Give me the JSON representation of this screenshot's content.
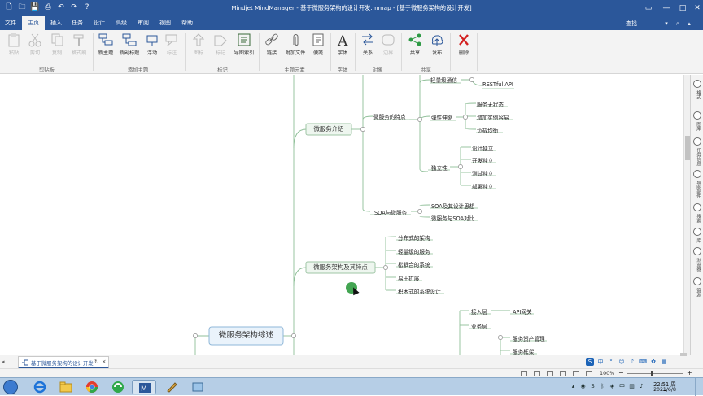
{
  "window": {
    "title": "Mindjet MindManager - 基于微服务架构的设计开发.mmap - [基于微服务架构的设计开发]",
    "quick_access": [
      "new-doc-icon",
      "open-folder-icon",
      "save-icon",
      "print-icon",
      "undo-icon",
      "redo-icon",
      "help-icon"
    ],
    "controls": {
      "minimize": "—",
      "maximize": "□",
      "close": "✕"
    }
  },
  "tabs": [
    "文件",
    "主页",
    "插入",
    "任务",
    "设计",
    "高级",
    "审阅",
    "视图",
    "帮助"
  ],
  "active_tab": "主页",
  "search_label": "查找",
  "ribbon": {
    "groups": [
      {
        "label": "剪贴板",
        "buttons": [
          {
            "label": "粘贴",
            "icon": "paste-icon",
            "enabled": false
          },
          {
            "label": "剪切",
            "icon": "cut-icon",
            "enabled": false
          },
          {
            "label": "复制",
            "icon": "copy-icon",
            "enabled": false
          },
          {
            "label": "格式刷",
            "icon": "format-painter-icon",
            "enabled": false
          }
        ]
      },
      {
        "label": "添加主题",
        "buttons": [
          {
            "label": "新主题",
            "icon": "new-topic-icon",
            "enabled": true
          },
          {
            "label": "新副标题",
            "icon": "new-subtopic-icon",
            "enabled": true
          },
          {
            "label": "浮动",
            "icon": "floating-topic-icon",
            "enabled": true
          },
          {
            "label": "标注",
            "icon": "callout-icon",
            "enabled": false
          }
        ]
      },
      {
        "label": "标记",
        "buttons": [
          {
            "label": "图标",
            "icon": "icon-marker-icon",
            "enabled": false
          },
          {
            "label": "标记",
            "icon": "tag-icon",
            "enabled": false
          },
          {
            "label": "导图索引",
            "icon": "map-index-icon",
            "enabled": true
          }
        ]
      },
      {
        "label": "主题元素",
        "buttons": [
          {
            "label": "链接",
            "icon": "link-icon",
            "enabled": true
          },
          {
            "label": "附加文件",
            "icon": "attach-file-icon",
            "enabled": true
          },
          {
            "label": "便笺",
            "icon": "notes-icon",
            "enabled": true
          }
        ]
      },
      {
        "label": "字体",
        "buttons": [
          {
            "label": "字体",
            "icon": "font-icon",
            "enabled": true
          }
        ]
      },
      {
        "label": "对象",
        "buttons": [
          {
            "label": "关系",
            "icon": "relationship-icon",
            "enabled": true
          },
          {
            "label": "边界",
            "icon": "boundary-icon",
            "enabled": false
          }
        ]
      },
      {
        "label": "共享",
        "buttons": [
          {
            "label": "共享",
            "icon": "share-icon",
            "enabled": true
          },
          {
            "label": "发布",
            "icon": "publish-icon",
            "enabled": true
          }
        ]
      },
      {
        "label": "",
        "buttons": [
          {
            "label": "删除",
            "icon": "delete-icon",
            "enabled": true
          }
        ]
      }
    ]
  },
  "mindmap": {
    "root": "微服务架构综述",
    "topic_intro": {
      "label": "微服务介绍",
      "features": {
        "label": "微服务的特点",
        "lightweight_comm": {
          "label": "轻量级通信",
          "child": "RESTful API"
        },
        "elastic": {
          "label": "弹性伸缩",
          "children": [
            "服务无状态",
            "增加实例容易",
            "负载均衡"
          ]
        },
        "independence": {
          "label": "独立性",
          "children": [
            "设计独立",
            "开发独立",
            "测试独立",
            "部署独立"
          ]
        }
      },
      "soa": {
        "label": "SOA与微服务",
        "children": [
          "SOA及其设计思想",
          "微服务与SOA对比"
        ]
      }
    },
    "topic_arch": {
      "label": "微服务架构及其特点",
      "children": [
        "分布式的架构",
        "轻量级的服务",
        "松耦合的系统",
        "易于扩展",
        "积木式的系统设计"
      ]
    },
    "topic_layers": {
      "access_layer": {
        "label": "接入层",
        "child": "API网关"
      },
      "service_layer": {
        "label": "业务层",
        "children": [
          "服务资产管理",
          "服务框架"
        ]
      }
    }
  },
  "right_panel": [
    {
      "icon": "format-icon",
      "label": "格式"
    },
    {
      "icon": "library-icon",
      "label": "图库"
    },
    {
      "icon": "task-icon",
      "label": "任务信息"
    },
    {
      "icon": "map-parts-icon",
      "label": "导图部件"
    },
    {
      "icon": "search-panel-icon",
      "label": "搜索"
    },
    {
      "icon": "library-icon2",
      "label": "库"
    },
    {
      "icon": "browser-icon",
      "label": "浏览器"
    },
    {
      "icon": "resource-icon",
      "label": "资源"
    }
  ],
  "doc_tab": {
    "label": "基于微服务架构的设计开发"
  },
  "status": {
    "zoom": "100%"
  },
  "tray": {
    "time": "22:51 周二",
    "date": "2021/6/8"
  },
  "taskbar_apps": [
    "ie-icon",
    "folder-icon",
    "chrome-icon",
    "sogou-icon",
    "mindmanager-icon",
    "paint-icon",
    "app-icon"
  ],
  "colors": {
    "accent": "#2b579a",
    "topic_border": "#9fc5a6",
    "topic_fill": "#eef6ef",
    "line": "#8fbf98"
  }
}
